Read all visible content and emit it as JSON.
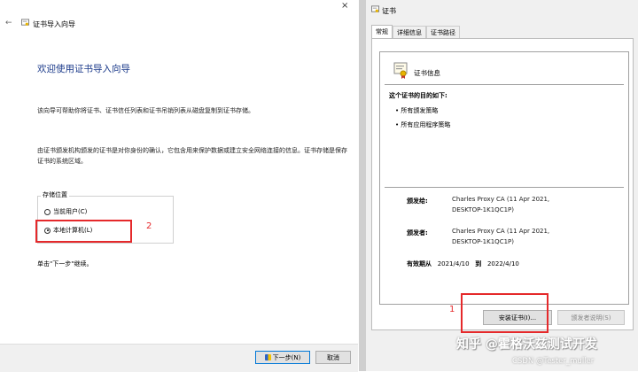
{
  "wizard": {
    "title": "证书导入向导",
    "close_glyph": "×",
    "back_glyph": "←",
    "heading": "欢迎使用证书导入向导",
    "para1": "该向导可帮助你将证书、证书信任列表和证书吊销列表从磁盘复制到证书存储。",
    "para2": "由证书颁发机构颁发的证书是对你身份的确认，它包含用来保护数据或建立安全网络连接的信息。证书存储是保存证书的系统区域。",
    "store_location": {
      "legend": "存储位置",
      "options": [
        "当前用户(C)",
        "本地计算机(L)"
      ],
      "selected": "本地计算机(L)"
    },
    "para3": "单击\"下一步\"继续。",
    "next_button": "下一步(N)",
    "cancel_button": "取消",
    "annotation_number": "2"
  },
  "cert_window": {
    "title": "证书",
    "tabs": [
      "常规",
      "详细信息",
      "证书路径"
    ],
    "active_tab": "常规",
    "info_title": "证书信息",
    "purpose_heading": "这个证书的目的如下:",
    "purposes": [
      "所有颁发策略",
      "所有应用程序策略"
    ],
    "issued_to_label": "颁发给:",
    "issued_to_line1": "Charles Proxy CA (11 Apr 2021,",
    "issued_to_line2": "DESKTOP-1K1QC1P)",
    "issued_by_label": "颁发者:",
    "issued_by_line1": "Charles Proxy CA (11 Apr 2021,",
    "issued_by_line2": "DESKTOP-1K1QC1P)",
    "validity_label": "有效期从",
    "valid_from": "2021/4/10",
    "to_label": "到",
    "valid_to": "2022/4/10",
    "install_button": "安装证书(I)...",
    "statement_button": "颁发者说明(S)",
    "annotation_number": "1"
  },
  "watermark": "知乎 @霍格沃兹测试开发",
  "csdn_mark": "CSDN @Tester_muller",
  "colors": {
    "annotation_red": "#e5292b",
    "heading_blue": "#1b3a8a"
  }
}
